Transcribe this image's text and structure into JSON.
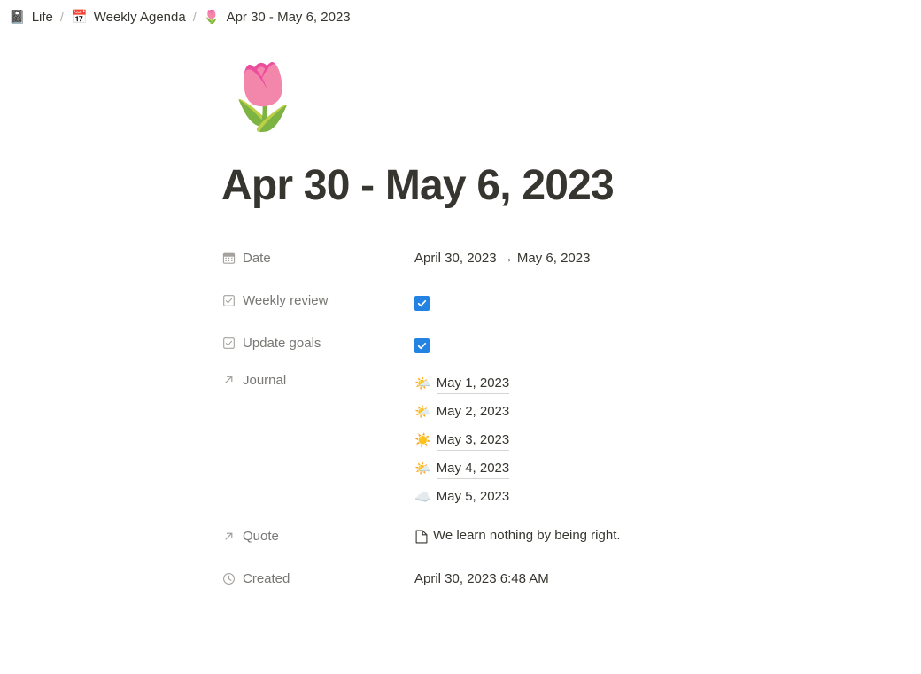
{
  "breadcrumb": {
    "items": [
      {
        "emoji": "📓",
        "icon_name": "notebook-emoji",
        "label": "Life"
      },
      {
        "emoji": "📅",
        "icon_name": "calendar-emoji",
        "label": "Weekly Agenda"
      },
      {
        "emoji": "🌷",
        "icon_name": "tulip-emoji",
        "label": "Apr 30 - May 6, 2023"
      }
    ],
    "separator": "/"
  },
  "page": {
    "emoji": "🌷",
    "emoji_name": "tulip-emoji",
    "title": "Apr 30 - May 6, 2023"
  },
  "properties": {
    "date": {
      "icon": "calendar-icon",
      "label": "Date",
      "value": "April 30, 2023 → May 6, 2023"
    },
    "weekly_review": {
      "icon": "checkbox-property-icon",
      "label": "Weekly review",
      "checked": true
    },
    "update_goals": {
      "icon": "checkbox-property-icon",
      "label": "Update goals",
      "checked": true
    },
    "journal": {
      "icon": "relation-arrow-icon",
      "label": "Journal",
      "entries": [
        {
          "emoji": "🌤️",
          "emoji_name": "sun-behind-small-cloud-emoji",
          "label": "May 1, 2023"
        },
        {
          "emoji": "🌤️",
          "emoji_name": "sun-behind-small-cloud-emoji",
          "label": "May 2, 2023"
        },
        {
          "emoji": "☀️",
          "emoji_name": "sun-emoji",
          "label": "May 3, 2023"
        },
        {
          "emoji": "🌤️",
          "emoji_name": "sun-behind-small-cloud-emoji",
          "label": "May 4, 2023"
        },
        {
          "emoji": "☁️",
          "emoji_name": "cloud-emoji",
          "label": "May 5, 2023"
        }
      ]
    },
    "quote": {
      "icon": "relation-arrow-icon",
      "label": "Quote",
      "value_icon": "page-icon",
      "value": "We learn nothing by being right."
    },
    "created": {
      "icon": "clock-icon",
      "label": "Created",
      "value": "April 30, 2023 6:48 AM"
    }
  },
  "colors": {
    "accent": "#2383e2",
    "text": "#37352f",
    "muted": "#787774",
    "icon": "#a5a29e",
    "underline": "#d6d4d0"
  }
}
